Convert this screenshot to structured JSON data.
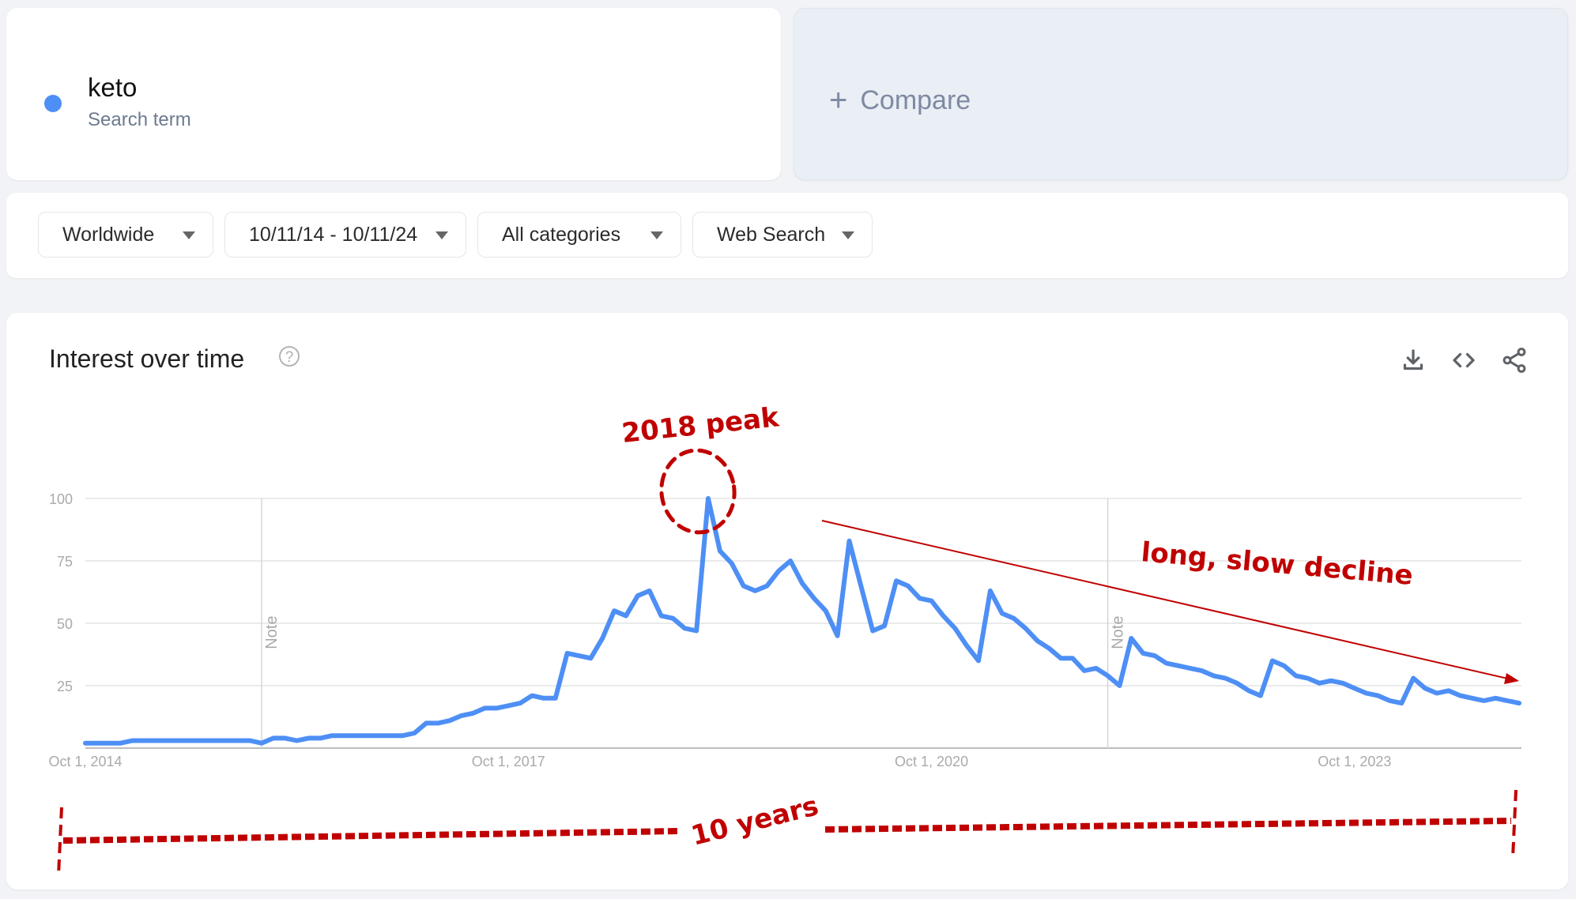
{
  "search_term": {
    "name": "keto",
    "subtitle": "Search term",
    "color": "#4e8ff5"
  },
  "compare": {
    "label": "Compare",
    "icon": "plus-icon"
  },
  "filters": {
    "region": "Worldwide",
    "date_range": "10/11/14 - 10/11/24",
    "category": "All categories",
    "search_type": "Web Search"
  },
  "panel": {
    "title": "Interest over time",
    "help_icon": "question-circle-icon",
    "actions": [
      "download-icon",
      "embed-code-icon",
      "share-icon"
    ]
  },
  "annotations": {
    "peak_label": "2018 peak",
    "decline_label": "long, slow decline",
    "span_label": "10 years",
    "color": "#c00000"
  },
  "chart_data": {
    "type": "line",
    "title": "Interest over time",
    "xlabel": "",
    "ylabel": "",
    "ylim": [
      0,
      100
    ],
    "yticks": [
      25,
      50,
      75,
      100
    ],
    "xtick_labels": [
      "Oct 1, 2014",
      "Oct 1, 2017",
      "Oct 1, 2020",
      "Oct 1, 2023"
    ],
    "x_range": [
      "Oct 2014",
      "Oct 2024"
    ],
    "grid": true,
    "legend": "none",
    "notes": [
      {
        "label": "Note",
        "x_index": 15
      },
      {
        "label": "Note",
        "x_index": 87
      }
    ],
    "series": [
      {
        "name": "keto",
        "color": "#4e8ff5",
        "values": [
          2,
          2,
          2,
          2,
          3,
          3,
          3,
          3,
          3,
          3,
          3,
          3,
          3,
          3,
          3,
          2,
          4,
          4,
          3,
          4,
          4,
          5,
          5,
          5,
          5,
          5,
          5,
          5,
          6,
          10,
          10,
          11,
          13,
          14,
          16,
          16,
          17,
          18,
          21,
          20,
          20,
          38,
          37,
          36,
          44,
          55,
          53,
          61,
          63,
          53,
          52,
          48,
          47,
          100,
          79,
          74,
          65,
          63,
          65,
          71,
          75,
          66,
          60,
          55,
          45,
          83,
          65,
          47,
          49,
          67,
          65,
          60,
          59,
          53,
          48,
          41,
          35,
          63,
          54,
          52,
          48,
          43,
          40,
          36,
          36,
          31,
          32,
          29,
          25,
          44,
          38,
          37,
          34,
          33,
          32,
          31,
          29,
          28,
          26,
          23,
          21,
          35,
          33,
          29,
          28,
          26,
          27,
          26,
          24,
          22,
          21,
          19,
          18,
          28,
          24,
          22,
          23,
          21,
          20,
          19,
          20,
          19,
          18
        ]
      }
    ]
  }
}
